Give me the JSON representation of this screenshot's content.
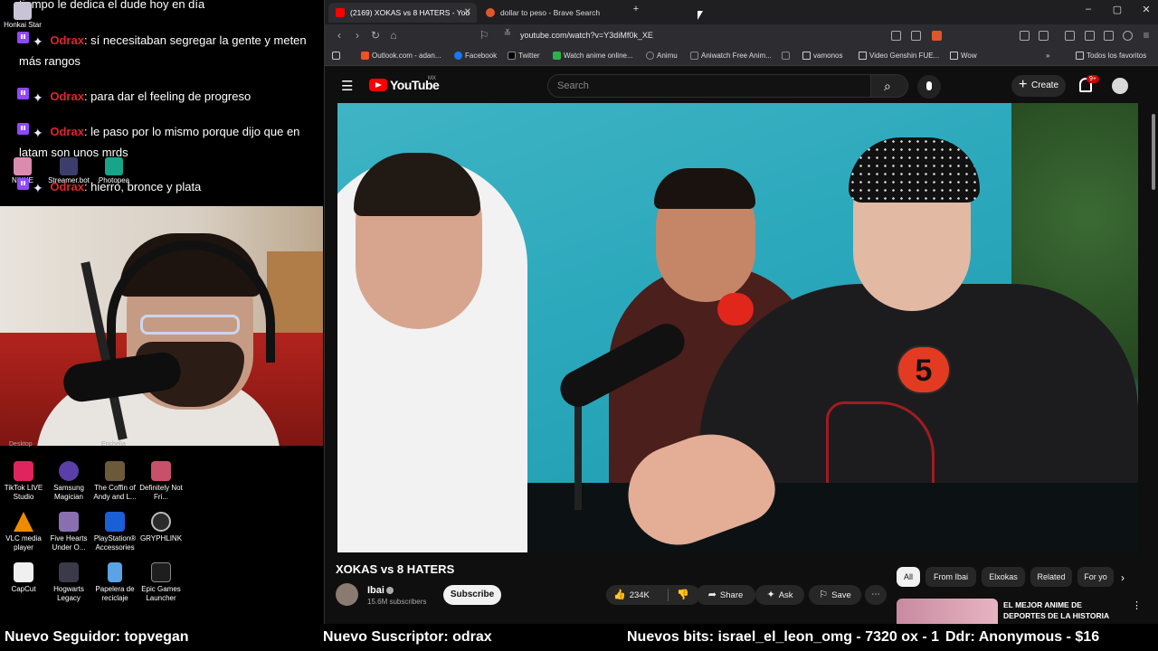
{
  "chat": {
    "header_partial": "tiempo le dedica el dude hoy en día",
    "messages": [
      {
        "user": "Odrax",
        "text": ": sí necesitaban segregar la gente y meten más rangos"
      },
      {
        "user": "Odrax",
        "text": ": para dar el feeling de progreso"
      },
      {
        "user": "Odrax",
        "text": ": le paso por lo mismo porque dijo que en latam son unos mrds"
      },
      {
        "user": "Odrax",
        "text": ": hierro, bronce y plata"
      }
    ],
    "overlay_icons": [
      {
        "label": "Honkai Star",
        "icon": "honkai-star-icon"
      },
      {
        "label": "NIKKE",
        "icon": "nikke-icon"
      },
      {
        "label": "Streamer.bot",
        "icon": "streamerbot-icon"
      },
      {
        "label": "Photopea",
        "icon": "photopea-icon"
      }
    ]
  },
  "desktop": {
    "partial_labels": [
      "Desktop",
      "Enchella"
    ],
    "icons": [
      {
        "label": "TikTok LIVE Studio",
        "icon": "tiktok-live-icon",
        "color": "#e0245e"
      },
      {
        "label": "Samsung Magician",
        "icon": "samsung-magician-icon",
        "color": "#5b3fa8"
      },
      {
        "label": "The Coffin of Andy and L...",
        "icon": "coffin-andy-icon",
        "color": "#6b5a3a"
      },
      {
        "label": "Definitely Not Fri...",
        "icon": "definitely-not-icon",
        "color": "#c9506a"
      },
      {
        "label": "VLC media player",
        "icon": "vlc-icon",
        "color": "#f08a00"
      },
      {
        "label": "Five Hearts Under O...",
        "icon": "five-hearts-icon",
        "color": "#8a6fb0"
      },
      {
        "label": "PlayStation® Accessories",
        "icon": "playstation-icon",
        "color": "#1b5fd6"
      },
      {
        "label": "GRYPHLINK",
        "icon": "gryphlink-icon",
        "color": "#2b2b2b"
      },
      {
        "label": "CapCut",
        "icon": "capcut-icon",
        "color": "#f0f0f0"
      },
      {
        "label": "Hogwarts Legacy",
        "icon": "hogwarts-icon",
        "color": "#3a3a4a"
      },
      {
        "label": "Papelera de reciclaje",
        "icon": "recycle-bin-icon",
        "color": "#5aa4e6"
      },
      {
        "label": "Epic Games Launcher",
        "icon": "epic-games-icon",
        "color": "#1e1e1e"
      }
    ]
  },
  "browser": {
    "tabs": [
      {
        "title": "(2169) XOKAS vs 8 HATERS - You",
        "icon": "youtube-icon",
        "active": true
      },
      {
        "title": "dollar to peso - Brave Search",
        "icon": "brave-icon",
        "active": false
      }
    ],
    "new_tab": "+",
    "url": "youtube.com/watch?v=Y3diMf0k_XE",
    "bookmarks": [
      {
        "label": "Outlook.com - adan...",
        "icon": "microsoft-icon",
        "color": "#f25022"
      },
      {
        "label": "Facebook",
        "icon": "facebook-icon",
        "color": "#1877f2"
      },
      {
        "label": "Twitter",
        "icon": "x-icon",
        "color": "#000000"
      },
      {
        "label": "Watch anime online...",
        "icon": "anime-site-icon",
        "color": "#2bb24c"
      },
      {
        "label": "Animu",
        "icon": "animu-icon",
        "color": "#888888"
      },
      {
        "label": "Aniwatch Free Anim...",
        "icon": "aniwatch-icon",
        "color": "#888888"
      },
      {
        "label": "",
        "icon": "y-icon",
        "color": "#888888"
      },
      {
        "label": "vamonos",
        "icon": "folder-icon",
        "color": "#cccccc"
      },
      {
        "label": "Video Genshin FUE...",
        "icon": "folder-icon",
        "color": "#cccccc"
      },
      {
        "label": "Wow",
        "icon": "folder-icon",
        "color": "#cccccc"
      }
    ],
    "all_bookmarks": "Todos los favoritos"
  },
  "youtube": {
    "logo_text": "YouTube",
    "region": "MX",
    "search_placeholder": "Search",
    "create_label": "Create",
    "notifications": "9+",
    "video": {
      "title": "XOKAS vs 8 HATERS",
      "jersey_number": "5"
    },
    "channel": {
      "name": "Ibai",
      "subscribers": "15.6M subscribers",
      "subscribe_label": "Subscribe"
    },
    "actions": {
      "likes": "234K",
      "share": "Share",
      "ask": "Ask",
      "save": "Save"
    },
    "chips": [
      "All",
      "From Ibai",
      "Elxokas",
      "Related",
      "For yo"
    ],
    "recommendation": {
      "title": "EL MEJOR ANIME DE DEPORTES DE LA HISTORIA"
    }
  },
  "ticker": {
    "follower": "Nuevo Seguidor: topvegan",
    "subscriber": "Nuevo Suscriptor: odrax",
    "bits": "Nuevos bits: israel_el_leon_omg - 7320 ox - 1",
    "donor": "Ddr: Anonymous - $16"
  },
  "colors": {
    "chat_username": "#e3242b",
    "youtube_red": "#ff0000",
    "twitch_purple": "#9146ff"
  }
}
